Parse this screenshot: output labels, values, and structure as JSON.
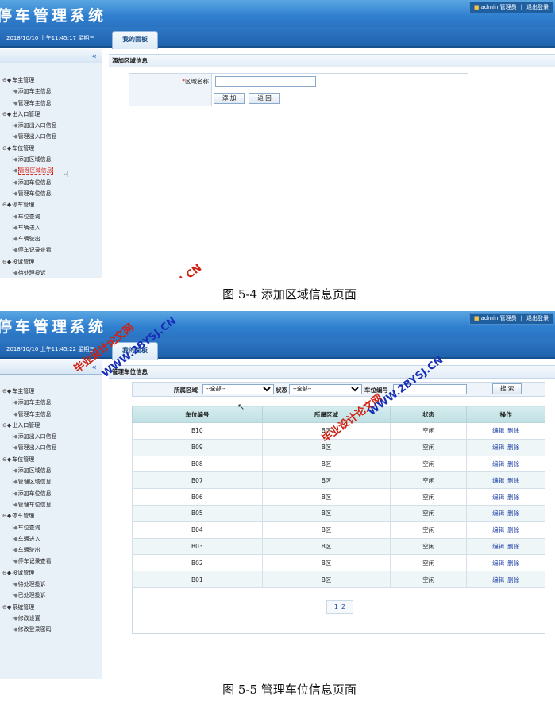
{
  "shot1": {
    "app_title": "停车管理系统",
    "user": {
      "name": "admin",
      "role": "管理员",
      "logout": "退出登录"
    },
    "datetime": "2018/10/10 上午11:45:17 星期三",
    "tab": "我的面板",
    "collapse_glyph": "«",
    "panel_title": "添加区域信息",
    "form": {
      "required_mark": "*",
      "label": "区域名称",
      "value": "",
      "add_button": "添 加",
      "back_button": "返 回"
    },
    "menu": [
      {
        "group": "车主管理",
        "items": [
          "添加车主信息",
          "管理车主信息"
        ]
      },
      {
        "group": "出入口管理",
        "items": [
          "添加出入口信息",
          "管理出入口信息"
        ]
      },
      {
        "group": "车位管理",
        "items": [
          "添加区域信息",
          "管理区域信息",
          "添加车位信息",
          "管理车位信息"
        ]
      },
      {
        "group": "停车管理",
        "items": [
          "车位查询",
          "车辆进入",
          "车辆驶出",
          "停车记录查看"
        ]
      },
      {
        "group": "投诉管理",
        "items": [
          "待处理投诉"
        ]
      }
    ],
    "active_item": "管理区域信息"
  },
  "caption1": "图 5-4 添加区域信息页面",
  "shot2": {
    "app_title": "停车管理系统",
    "user": {
      "name": "admin",
      "role": "管理员",
      "logout": "退出登录"
    },
    "datetime": "2018/10/10 上午11:45:22 星期三",
    "tab": "我的面板",
    "collapse_glyph": "«",
    "panel_title": "管理车位信息",
    "search": {
      "area_label": "所属区域",
      "area_selected": "--全部--",
      "status_label": "状态",
      "status_selected": "--全部--",
      "number_label": "车位编号",
      "number_value": "",
      "search_button": "搜 索"
    },
    "table": {
      "headers": [
        "车位编号",
        "所属区域",
        "状态",
        "操作"
      ],
      "rows": [
        [
          "B10",
          "B区",
          "空闲"
        ],
        [
          "B09",
          "B区",
          "空闲"
        ],
        [
          "B08",
          "B区",
          "空闲"
        ],
        [
          "B07",
          "B区",
          "空闲"
        ],
        [
          "B06",
          "B区",
          "空闲"
        ],
        [
          "B05",
          "B区",
          "空闲"
        ],
        [
          "B04",
          "B区",
          "空闲"
        ],
        [
          "B03",
          "B区",
          "空闲"
        ],
        [
          "B02",
          "B区",
          "空闲"
        ],
        [
          "B01",
          "B区",
          "空闲"
        ]
      ],
      "edit_label": "编辑",
      "delete_label": "删除"
    },
    "pager": [
      "1",
      "2"
    ],
    "menu": [
      {
        "group": "车主管理",
        "items": [
          "添加车主信息",
          "管理车主信息"
        ]
      },
      {
        "group": "出入口管理",
        "items": [
          "添加出入口信息",
          "管理出入口信息"
        ]
      },
      {
        "group": "车位管理",
        "items": [
          "添加区域信息",
          "管理区域信息",
          "添加车位信息",
          "管理车位信息"
        ]
      },
      {
        "group": "停车管理",
        "items": [
          "车位查询",
          "车辆进入",
          "车辆驶出",
          "停车记录查看"
        ]
      },
      {
        "group": "投诉管理",
        "items": [
          "待处理投诉",
          "已处理投诉"
        ]
      },
      {
        "group": "系统管理",
        "items": [
          "修改设置",
          "修改登录密码"
        ]
      }
    ]
  },
  "caption2": "图 5-5 管理车位信息页面",
  "watermarks": {
    "site": "WWW.2BYSJ.CN",
    "name": "毕业设计论文网"
  },
  "colors": {
    "header_blue": "#2f7fcf",
    "active_red": "#d9281c",
    "watermark_red": "#d02010",
    "watermark_blue": "#1830b8"
  }
}
